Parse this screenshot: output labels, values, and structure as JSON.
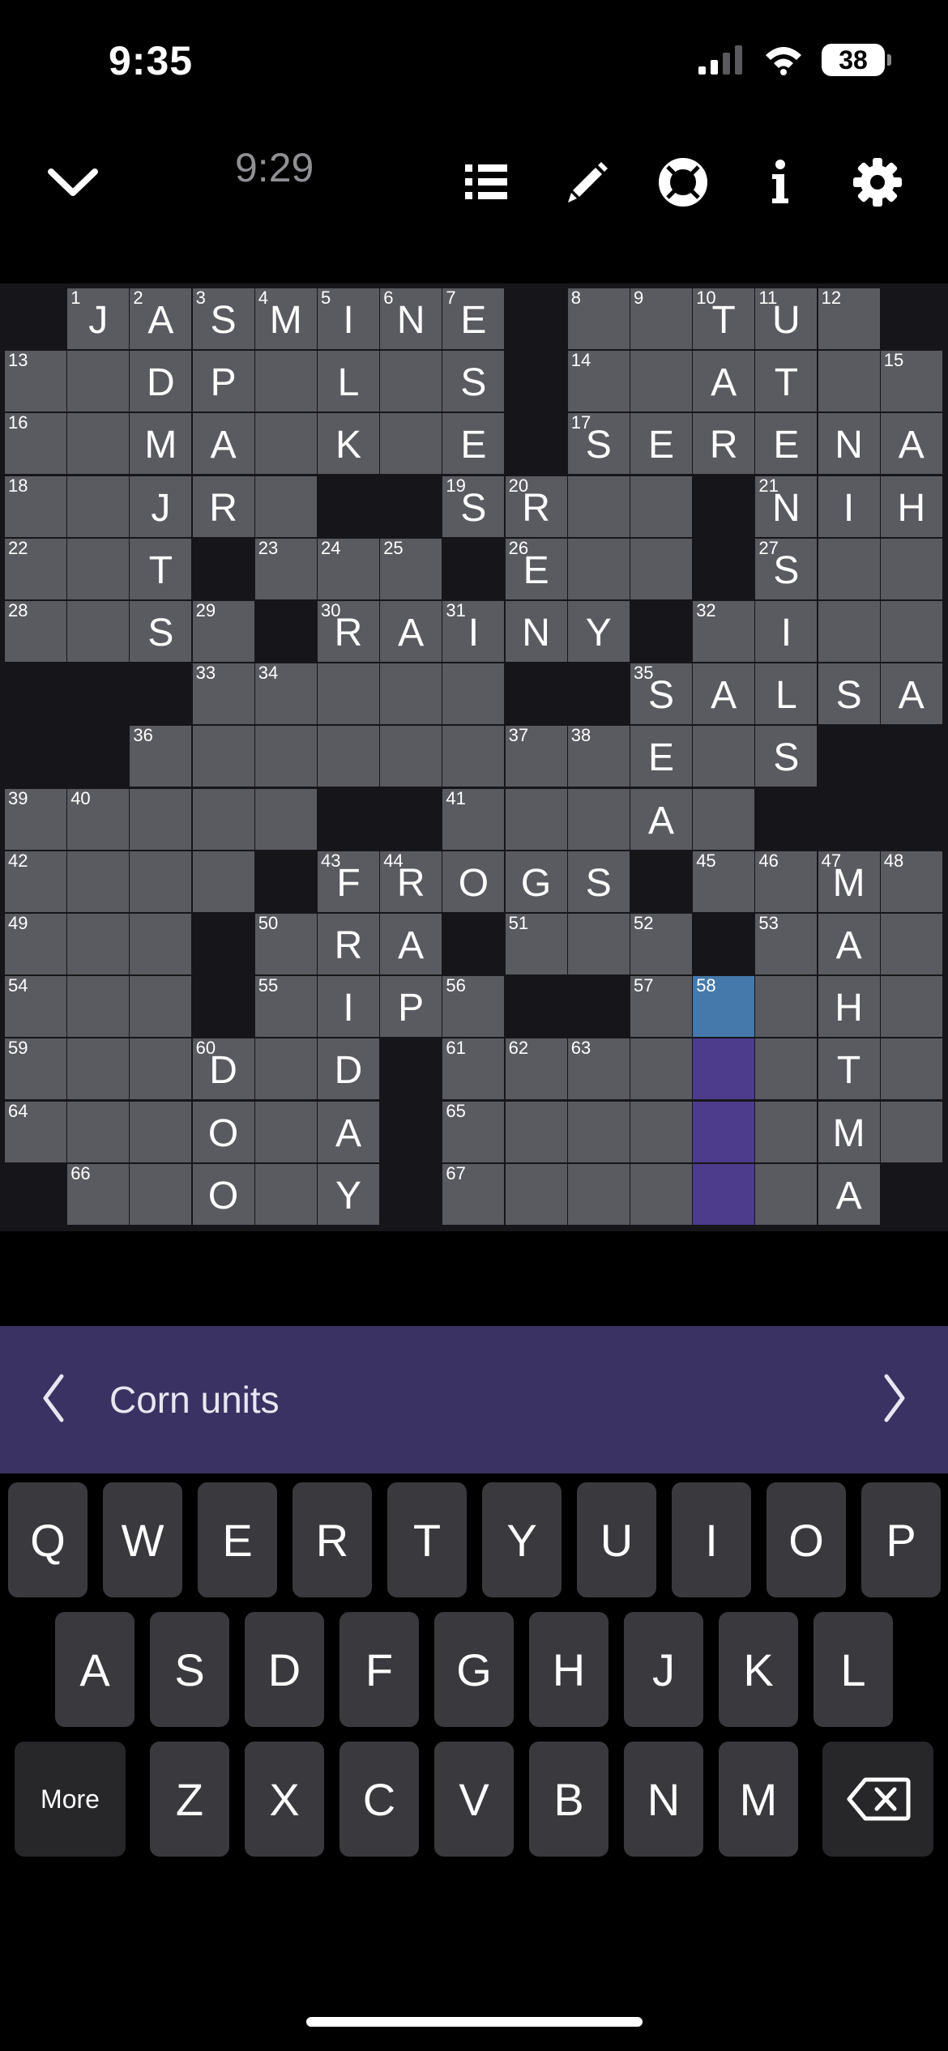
{
  "status": {
    "time": "9:35",
    "battery": "38"
  },
  "toolbar": {
    "timer": "9:29",
    "icons": [
      "chevron-down-icon",
      "clue-list-icon",
      "pencil-icon",
      "help-lifebuoy-icon",
      "info-icon",
      "settings-gear-icon"
    ]
  },
  "board": {
    "rows": 15,
    "cols": 15,
    "selected": {
      "row": 11,
      "col": 11
    },
    "word_cells": [
      [
        12,
        11
      ],
      [
        13,
        11
      ],
      [
        14,
        11
      ]
    ],
    "grid": [
      [
        "#",
        "J",
        "A",
        "S",
        "M",
        "I",
        "N",
        "E",
        "#",
        ".",
        ".",
        "T",
        "U",
        ".",
        "#"
      ],
      [
        ".",
        ".",
        "D",
        "P",
        ".",
        "L",
        ".",
        "S",
        "#",
        ".",
        ".",
        "A",
        "T",
        ".",
        "."
      ],
      [
        ".",
        ".",
        "M",
        "A",
        ".",
        "K",
        ".",
        "E",
        "#",
        "S",
        "E",
        "R",
        "E",
        "N",
        "A"
      ],
      [
        ".",
        ".",
        "J",
        "R",
        ".",
        "#",
        "#",
        "S",
        "R",
        ".",
        ".",
        "#",
        "N",
        "I",
        "H"
      ],
      [
        ".",
        ".",
        "T",
        "#",
        ".",
        ".",
        ".",
        "#",
        "E",
        ".",
        ".",
        "#",
        "S",
        ".",
        "."
      ],
      [
        ".",
        ".",
        "S",
        ".",
        "#",
        "R",
        "A",
        "I",
        "N",
        "Y",
        "#",
        ".",
        "I",
        ".",
        "."
      ],
      [
        "#",
        "#",
        "#",
        ".",
        ".",
        ".",
        ".",
        ".",
        "#",
        "#",
        "S",
        "A",
        "L",
        "S",
        "A"
      ],
      [
        "#",
        "#",
        ".",
        ".",
        ".",
        ".",
        ".",
        ".",
        ".",
        ".",
        "E",
        ".",
        "S",
        "#",
        "#"
      ],
      [
        ".",
        ".",
        ".",
        ".",
        ".",
        "#",
        "#",
        ".",
        ".",
        ".",
        "A",
        ".",
        "#",
        "#",
        "#"
      ],
      [
        ".",
        ".",
        ".",
        ".",
        "#",
        "F",
        "R",
        "O",
        "G",
        "S",
        "#",
        ".",
        ".",
        "M",
        "."
      ],
      [
        ".",
        ".",
        ".",
        "#",
        ".",
        "R",
        "A",
        "#",
        ".",
        ".",
        ".",
        "#",
        ".",
        "A",
        "."
      ],
      [
        ".",
        ".",
        ".",
        "#",
        ".",
        "I",
        "P",
        ".",
        "#",
        "#",
        ".",
        ".",
        ".",
        "H",
        "."
      ],
      [
        ".",
        ".",
        ".",
        "D",
        ".",
        "D",
        "#",
        ".",
        ".",
        ".",
        ".",
        ".",
        ".",
        "T",
        "."
      ],
      [
        ".",
        ".",
        ".",
        "O",
        ".",
        "A",
        "#",
        ".",
        ".",
        ".",
        ".",
        ".",
        ".",
        "M",
        "."
      ],
      [
        "#",
        ".",
        ".",
        "O",
        ".",
        "Y",
        "#",
        ".",
        ".",
        ".",
        ".",
        ".",
        ".",
        "A",
        "#"
      ]
    ],
    "numbers": [
      [
        0,
        1,
        "1"
      ],
      [
        0,
        2,
        "2"
      ],
      [
        0,
        3,
        "3"
      ],
      [
        0,
        4,
        "4"
      ],
      [
        0,
        5,
        "5"
      ],
      [
        0,
        6,
        "6"
      ],
      [
        0,
        7,
        "7"
      ],
      [
        0,
        9,
        "8"
      ],
      [
        0,
        10,
        "9"
      ],
      [
        0,
        11,
        "10"
      ],
      [
        0,
        12,
        "11"
      ],
      [
        0,
        13,
        "12"
      ],
      [
        1,
        0,
        "13"
      ],
      [
        1,
        9,
        "14"
      ],
      [
        1,
        14,
        "15"
      ],
      [
        2,
        0,
        "16"
      ],
      [
        2,
        9,
        "17"
      ],
      [
        3,
        0,
        "18"
      ],
      [
        3,
        7,
        "19"
      ],
      [
        3,
        8,
        "20"
      ],
      [
        3,
        12,
        "21"
      ],
      [
        4,
        0,
        "22"
      ],
      [
        4,
        4,
        "23"
      ],
      [
        4,
        5,
        "24"
      ],
      [
        4,
        6,
        "25"
      ],
      [
        4,
        8,
        "26"
      ],
      [
        4,
        12,
        "27"
      ],
      [
        5,
        0,
        "28"
      ],
      [
        5,
        3,
        "29"
      ],
      [
        5,
        5,
        "30"
      ],
      [
        5,
        7,
        "31"
      ],
      [
        5,
        11,
        "32"
      ],
      [
        6,
        3,
        "33"
      ],
      [
        6,
        4,
        "34"
      ],
      [
        6,
        10,
        "35"
      ],
      [
        7,
        2,
        "36"
      ],
      [
        7,
        8,
        "37"
      ],
      [
        7,
        9,
        "38"
      ],
      [
        8,
        0,
        "39"
      ],
      [
        8,
        1,
        "40"
      ],
      [
        8,
        7,
        "41"
      ],
      [
        9,
        0,
        "42"
      ],
      [
        9,
        5,
        "43"
      ],
      [
        9,
        6,
        "44"
      ],
      [
        9,
        11,
        "45"
      ],
      [
        9,
        12,
        "46"
      ],
      [
        9,
        13,
        "47"
      ],
      [
        9,
        14,
        "48"
      ],
      [
        10,
        0,
        "49"
      ],
      [
        10,
        4,
        "50"
      ],
      [
        10,
        8,
        "51"
      ],
      [
        10,
        10,
        "52"
      ],
      [
        10,
        12,
        "53"
      ],
      [
        11,
        0,
        "54"
      ],
      [
        11,
        4,
        "55"
      ],
      [
        11,
        7,
        "56"
      ],
      [
        11,
        10,
        "57"
      ],
      [
        11,
        11,
        "58"
      ],
      [
        12,
        0,
        "59"
      ],
      [
        12,
        3,
        "60"
      ],
      [
        12,
        7,
        "61"
      ],
      [
        12,
        8,
        "62"
      ],
      [
        12,
        9,
        "63"
      ],
      [
        13,
        0,
        "64"
      ],
      [
        13,
        7,
        "65"
      ],
      [
        14,
        1,
        "66"
      ],
      [
        14,
        7,
        "67"
      ]
    ]
  },
  "clue": {
    "text": "Corn units"
  },
  "keyboard": {
    "row1": [
      "Q",
      "W",
      "E",
      "R",
      "T",
      "Y",
      "U",
      "I",
      "O",
      "P"
    ],
    "row2": [
      "A",
      "S",
      "D",
      "F",
      "G",
      "H",
      "J",
      "K",
      "L"
    ],
    "row3": [
      "Z",
      "X",
      "C",
      "V",
      "B",
      "N",
      "M"
    ],
    "more_label": "More"
  },
  "colors": {
    "cell": "#5a5a61",
    "selected_cell": "#4579ab",
    "active_word": "#4d3b8b",
    "clue_bar": "#393262"
  }
}
